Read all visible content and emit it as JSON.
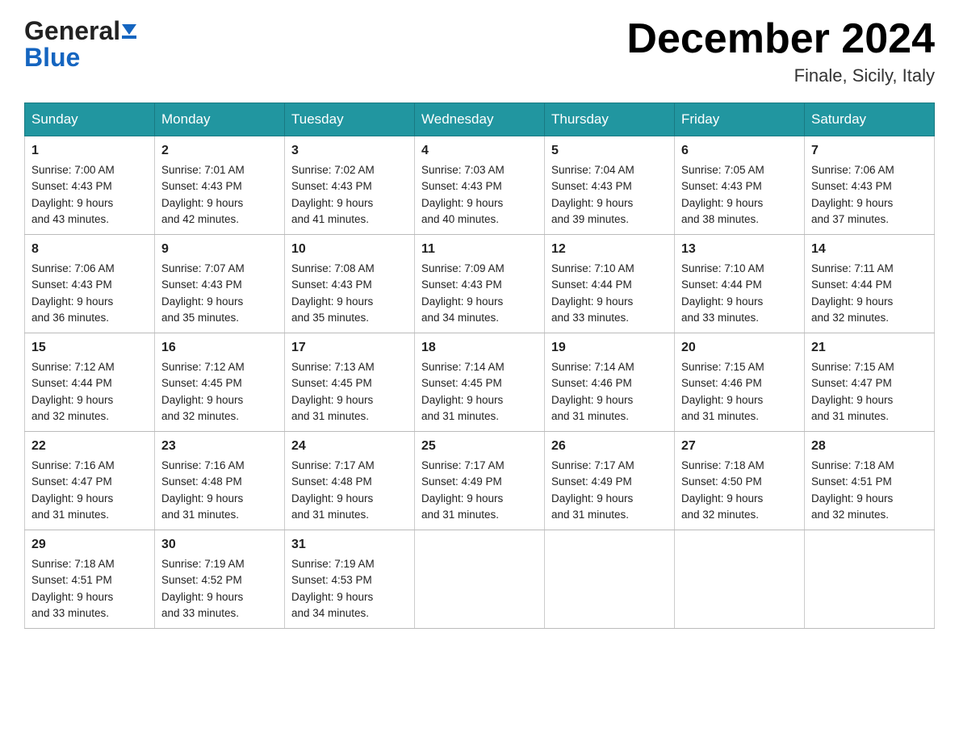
{
  "header": {
    "logo_general": "General",
    "logo_blue": "Blue",
    "month_title": "December 2024",
    "location": "Finale, Sicily, Italy"
  },
  "weekdays": [
    "Sunday",
    "Monday",
    "Tuesday",
    "Wednesday",
    "Thursday",
    "Friday",
    "Saturday"
  ],
  "weeks": [
    [
      {
        "day": "1",
        "sunrise": "7:00 AM",
        "sunset": "4:43 PM",
        "daylight": "9 hours and 43 minutes."
      },
      {
        "day": "2",
        "sunrise": "7:01 AM",
        "sunset": "4:43 PM",
        "daylight": "9 hours and 42 minutes."
      },
      {
        "day": "3",
        "sunrise": "7:02 AM",
        "sunset": "4:43 PM",
        "daylight": "9 hours and 41 minutes."
      },
      {
        "day": "4",
        "sunrise": "7:03 AM",
        "sunset": "4:43 PM",
        "daylight": "9 hours and 40 minutes."
      },
      {
        "day": "5",
        "sunrise": "7:04 AM",
        "sunset": "4:43 PM",
        "daylight": "9 hours and 39 minutes."
      },
      {
        "day": "6",
        "sunrise": "7:05 AM",
        "sunset": "4:43 PM",
        "daylight": "9 hours and 38 minutes."
      },
      {
        "day": "7",
        "sunrise": "7:06 AM",
        "sunset": "4:43 PM",
        "daylight": "9 hours and 37 minutes."
      }
    ],
    [
      {
        "day": "8",
        "sunrise": "7:06 AM",
        "sunset": "4:43 PM",
        "daylight": "9 hours and 36 minutes."
      },
      {
        "day": "9",
        "sunrise": "7:07 AM",
        "sunset": "4:43 PM",
        "daylight": "9 hours and 35 minutes."
      },
      {
        "day": "10",
        "sunrise": "7:08 AM",
        "sunset": "4:43 PM",
        "daylight": "9 hours and 35 minutes."
      },
      {
        "day": "11",
        "sunrise": "7:09 AM",
        "sunset": "4:43 PM",
        "daylight": "9 hours and 34 minutes."
      },
      {
        "day": "12",
        "sunrise": "7:10 AM",
        "sunset": "4:44 PM",
        "daylight": "9 hours and 33 minutes."
      },
      {
        "day": "13",
        "sunrise": "7:10 AM",
        "sunset": "4:44 PM",
        "daylight": "9 hours and 33 minutes."
      },
      {
        "day": "14",
        "sunrise": "7:11 AM",
        "sunset": "4:44 PM",
        "daylight": "9 hours and 32 minutes."
      }
    ],
    [
      {
        "day": "15",
        "sunrise": "7:12 AM",
        "sunset": "4:44 PM",
        "daylight": "9 hours and 32 minutes."
      },
      {
        "day": "16",
        "sunrise": "7:12 AM",
        "sunset": "4:45 PM",
        "daylight": "9 hours and 32 minutes."
      },
      {
        "day": "17",
        "sunrise": "7:13 AM",
        "sunset": "4:45 PM",
        "daylight": "9 hours and 31 minutes."
      },
      {
        "day": "18",
        "sunrise": "7:14 AM",
        "sunset": "4:45 PM",
        "daylight": "9 hours and 31 minutes."
      },
      {
        "day": "19",
        "sunrise": "7:14 AM",
        "sunset": "4:46 PM",
        "daylight": "9 hours and 31 minutes."
      },
      {
        "day": "20",
        "sunrise": "7:15 AM",
        "sunset": "4:46 PM",
        "daylight": "9 hours and 31 minutes."
      },
      {
        "day": "21",
        "sunrise": "7:15 AM",
        "sunset": "4:47 PM",
        "daylight": "9 hours and 31 minutes."
      }
    ],
    [
      {
        "day": "22",
        "sunrise": "7:16 AM",
        "sunset": "4:47 PM",
        "daylight": "9 hours and 31 minutes."
      },
      {
        "day": "23",
        "sunrise": "7:16 AM",
        "sunset": "4:48 PM",
        "daylight": "9 hours and 31 minutes."
      },
      {
        "day": "24",
        "sunrise": "7:17 AM",
        "sunset": "4:48 PM",
        "daylight": "9 hours and 31 minutes."
      },
      {
        "day": "25",
        "sunrise": "7:17 AM",
        "sunset": "4:49 PM",
        "daylight": "9 hours and 31 minutes."
      },
      {
        "day": "26",
        "sunrise": "7:17 AM",
        "sunset": "4:49 PM",
        "daylight": "9 hours and 31 minutes."
      },
      {
        "day": "27",
        "sunrise": "7:18 AM",
        "sunset": "4:50 PM",
        "daylight": "9 hours and 32 minutes."
      },
      {
        "day": "28",
        "sunrise": "7:18 AM",
        "sunset": "4:51 PM",
        "daylight": "9 hours and 32 minutes."
      }
    ],
    [
      {
        "day": "29",
        "sunrise": "7:18 AM",
        "sunset": "4:51 PM",
        "daylight": "9 hours and 33 minutes."
      },
      {
        "day": "30",
        "sunrise": "7:19 AM",
        "sunset": "4:52 PM",
        "daylight": "9 hours and 33 minutes."
      },
      {
        "day": "31",
        "sunrise": "7:19 AM",
        "sunset": "4:53 PM",
        "daylight": "9 hours and 34 minutes."
      },
      null,
      null,
      null,
      null
    ]
  ],
  "labels": {
    "sunrise": "Sunrise:",
    "sunset": "Sunset:",
    "daylight": "Daylight:"
  }
}
